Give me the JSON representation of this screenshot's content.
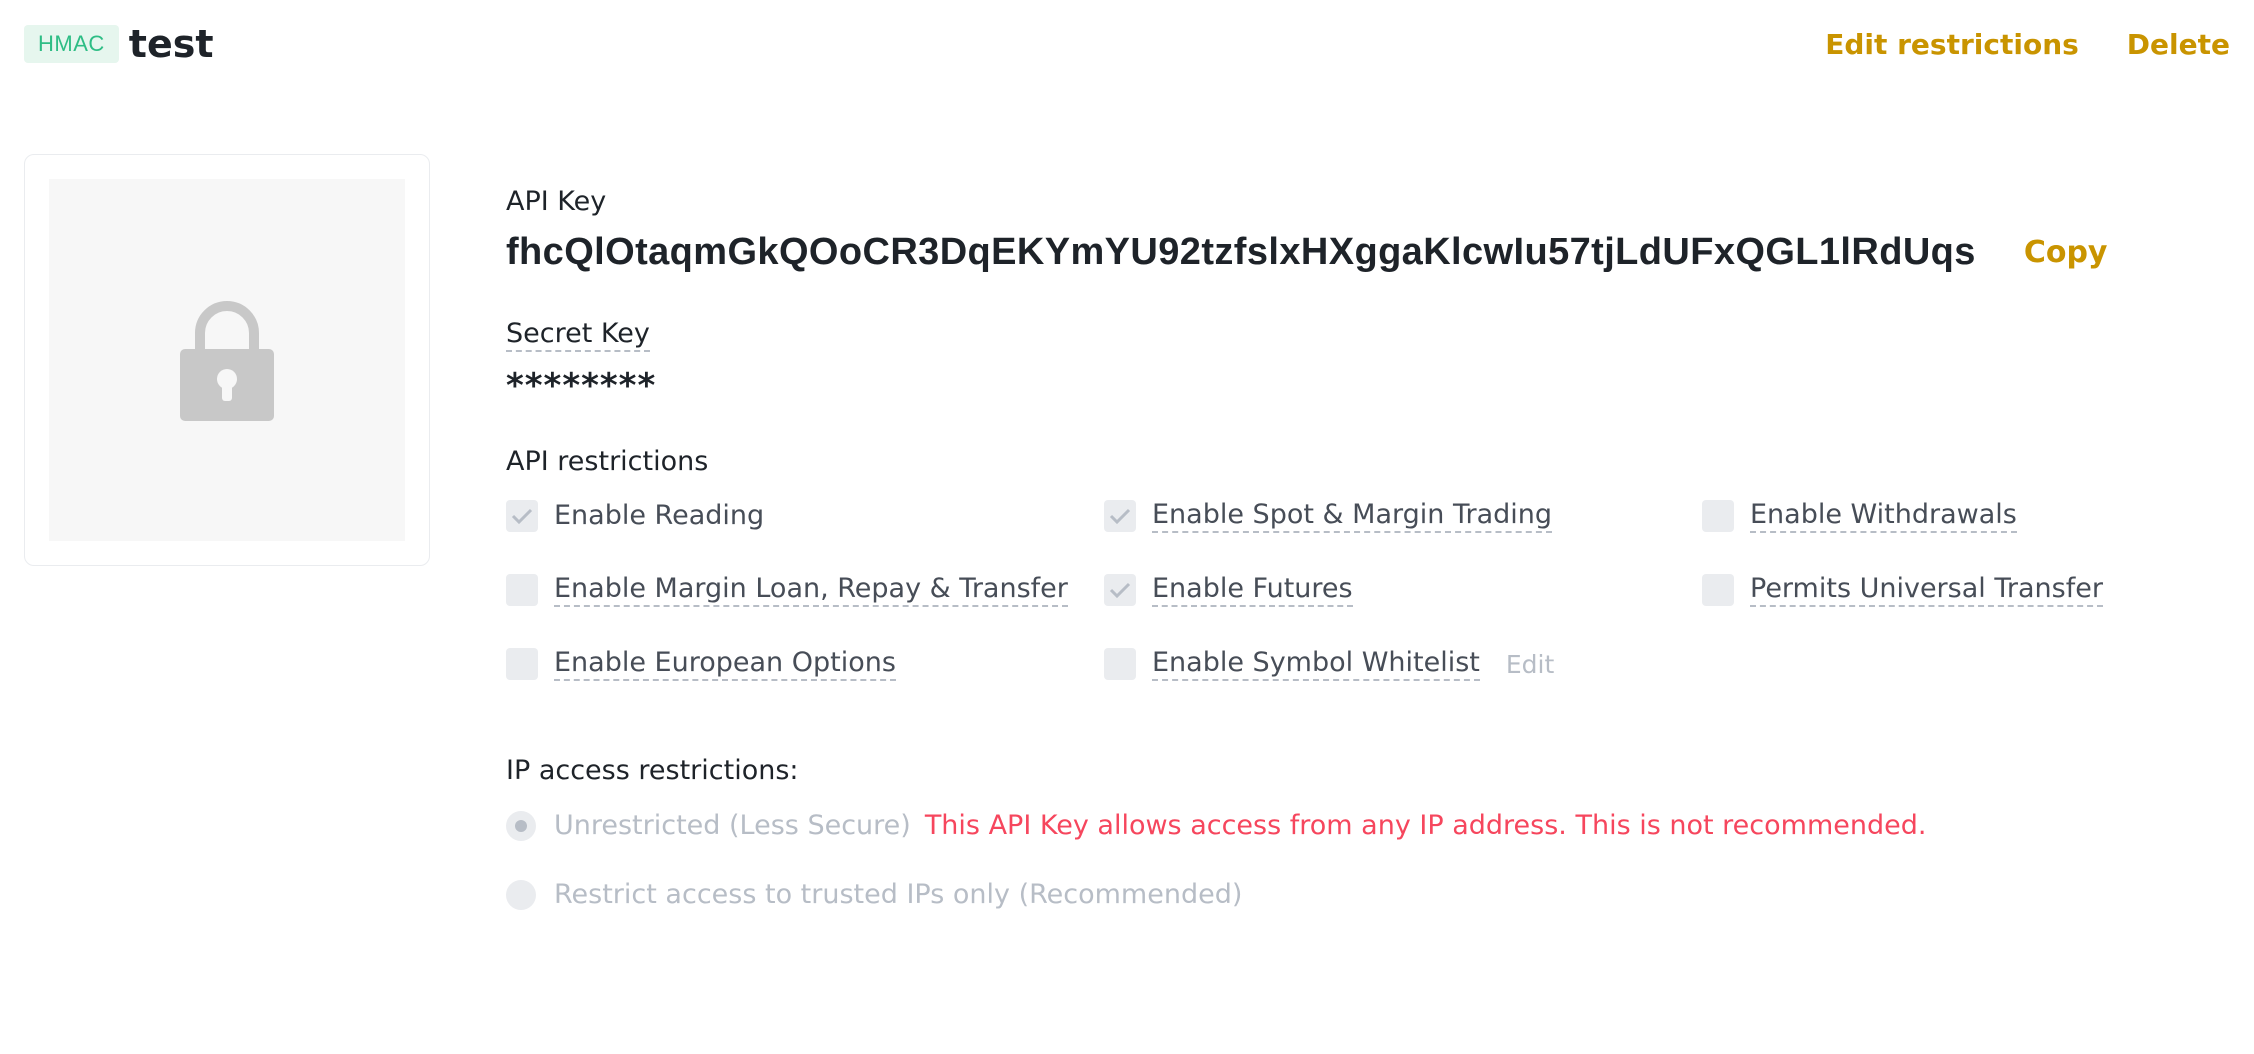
{
  "header": {
    "badge": "HMAC",
    "key_name": "test",
    "edit_restrictions": "Edit restrictions",
    "delete": "Delete"
  },
  "lock_card": {
    "icon": "lock-icon",
    "icon_color": "#c8c8c8"
  },
  "api_key": {
    "label": "API Key",
    "value": "fhcQlOtaqmGkQOoCR3DqEKYmYU92tzfslxHXggaKlcwIu57tjLdUFxQGL1lRdUqs",
    "copy": "Copy"
  },
  "secret_key": {
    "label": "Secret Key",
    "value": "********"
  },
  "api_restrictions": {
    "title": "API restrictions",
    "options": [
      {
        "label": "Enable Reading",
        "checked": true
      },
      {
        "label": "Enable Spot & Margin Trading",
        "checked": true
      },
      {
        "label": "Enable Withdrawals",
        "checked": false
      },
      {
        "label": "Enable Margin Loan, Repay & Transfer",
        "checked": false
      },
      {
        "label": "Enable Futures",
        "checked": true
      },
      {
        "label": "Permits Universal Transfer",
        "checked": false
      },
      {
        "label": "Enable European Options",
        "checked": false
      },
      {
        "label": "Enable Symbol Whitelist",
        "checked": false,
        "edit": "Edit"
      }
    ]
  },
  "ip_restrictions": {
    "title": "IP access restrictions:",
    "unrestricted": "Unrestricted (Less Secure)",
    "warning": "This API Key allows access from any IP address. This is not recommended.",
    "restricted": "Restrict access to trusted IPs only (Recommended)",
    "selected": "unrestricted"
  },
  "colors": {
    "accent": "#c99400",
    "badge_bg": "#e6f6ee",
    "badge_text": "#2ebd85",
    "warning": "#f6465d",
    "disabled": "#b7bdc6"
  }
}
